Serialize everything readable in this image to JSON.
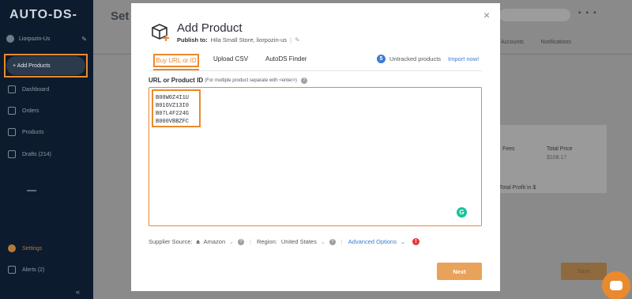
{
  "app": {
    "logo": "AUTO-DS-"
  },
  "sidebar": {
    "store_name": "Liorpozin-Us",
    "add_products": "+ Add Products",
    "items": [
      {
        "label": "Dashboard"
      },
      {
        "label": "Orders"
      },
      {
        "label": "Products"
      },
      {
        "label": "Drafts (214)"
      }
    ],
    "settings": "Settings",
    "alerts": "Alerts (2)",
    "collapse": "«"
  },
  "background": {
    "page_title": "Set",
    "tabs": [
      "Accounts",
      "Notifications"
    ],
    "fees_label": "Fees",
    "fees_value": "$7",
    "total_price_label": "Total Price",
    "total_price_value": "$108.17",
    "profit_label": "Total Profit in $",
    "save_label": "Save"
  },
  "modal": {
    "title": "Add Product",
    "publish_label": "Publish to:",
    "publish_value": "Hila Small Store, liorpozin-us",
    "close": "×",
    "tabs": [
      {
        "label": "Buy URL or ID",
        "active": true
      },
      {
        "label": "Upload CSV",
        "active": false
      },
      {
        "label": "AutoDS Finder",
        "active": false
      }
    ],
    "untracked_count": "5",
    "untracked_label": "Untracked products",
    "import_now": "Import now!",
    "url_label": "URL or Product ID",
    "url_hint": "(For multiple product separate with <enter>)",
    "product_ids": [
      "B00W0Z4I1U",
      "B01GVZ13I0",
      "B07L4F224G",
      "B000VBBZFC"
    ],
    "supplier_label": "Supplier Source:",
    "supplier_value": "Amazon",
    "region_label": "Region:",
    "region_value": "United States",
    "advanced_options": "Advanced Options",
    "next_label": "Next"
  },
  "colors": {
    "accent": "#e98a2e",
    "link": "#3a7bd5",
    "sidebar_bg": "#0d1b2e",
    "next_button": "#e8a25a"
  }
}
